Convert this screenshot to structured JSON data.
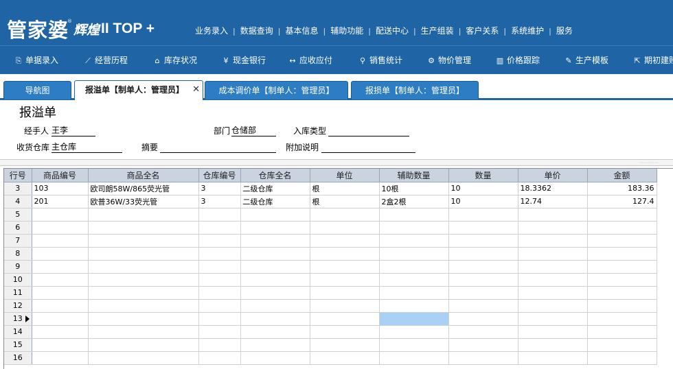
{
  "header": {
    "logo_main": "管家婆",
    "logo_reg": "®",
    "logo_sub": "辉煌",
    "logo_edition": "II TOP +",
    "menu": [
      "业务录入",
      "数据查询",
      "基本信息",
      "辅助功能",
      "配送中心",
      "生产组装",
      "客户关系",
      "系统维护",
      "服务"
    ],
    "menu_sep": "|"
  },
  "toolbar": [
    {
      "icon": "document-icon",
      "glyph": "⎘",
      "label": "单据录入"
    },
    {
      "icon": "trend-chart-icon",
      "glyph": "⟋",
      "label": "经营历程"
    },
    {
      "icon": "home-icon",
      "glyph": "⌂",
      "label": "库存状况"
    },
    {
      "icon": "yen-icon",
      "glyph": "¥",
      "label": "现金银行"
    },
    {
      "icon": "exchange-icon",
      "glyph": "↔",
      "label": "应收应付"
    },
    {
      "icon": "search-icon",
      "glyph": "⚲",
      "label": "销售统计"
    },
    {
      "icon": "gear-icon",
      "glyph": "⚙",
      "label": "物价管理"
    },
    {
      "icon": "bar-chart-icon",
      "glyph": "▥",
      "label": "价格跟踪"
    },
    {
      "icon": "wrench-icon",
      "glyph": "✎",
      "label": "生产模板"
    },
    {
      "icon": "external-link-icon",
      "glyph": "⇱",
      "label": "期初建账"
    }
  ],
  "tabs": [
    {
      "label": "导航图",
      "active": false
    },
    {
      "label": "报溢单【制单人：管理员】",
      "active": true,
      "close": "✕"
    },
    {
      "label": "成本调价单【制单人：管理员】",
      "active": false
    },
    {
      "label": "报损单【制单人：管理员】",
      "active": false
    }
  ],
  "form": {
    "title": "报溢单",
    "handler_label": "经手人",
    "handler_value": "王李",
    "dept_label": "部门",
    "dept_value": "仓储部",
    "intype_label": "入库类型",
    "intype_value": "",
    "warehouse_label": "收货仓库",
    "warehouse_value": "主仓库",
    "summary_label": "摘要",
    "summary_value": "",
    "note_label": "附加说明",
    "note_value": ""
  },
  "grid": {
    "columns": [
      "行号",
      "商品编号",
      "商品全名",
      "仓库编号",
      "仓库全名",
      "单位",
      "辅助数量",
      "数量",
      "单价",
      "金额"
    ],
    "rows": [
      {
        "no": "3",
        "cells": [
          "103",
          "欧司朗58W/865荧光管",
          "3",
          "二级仓库",
          "根",
          "10根",
          "10",
          "18.3362",
          "183.36"
        ]
      },
      {
        "no": "4",
        "cells": [
          "201",
          "欧普36W/33荧光管",
          "3",
          "二级仓库",
          "根",
          "2盒2根",
          "10",
          "12.74",
          "127.4"
        ]
      },
      {
        "no": "5",
        "cells": [
          "",
          "",
          "",
          "",
          "",
          "",
          "",
          "",
          ""
        ]
      },
      {
        "no": "6",
        "cells": [
          "",
          "",
          "",
          "",
          "",
          "",
          "",
          "",
          ""
        ]
      },
      {
        "no": "7",
        "cells": [
          "",
          "",
          "",
          "",
          "",
          "",
          "",
          "",
          ""
        ]
      },
      {
        "no": "8",
        "cells": [
          "",
          "",
          "",
          "",
          "",
          "",
          "",
          "",
          ""
        ]
      },
      {
        "no": "9",
        "cells": [
          "",
          "",
          "",
          "",
          "",
          "",
          "",
          "",
          ""
        ]
      },
      {
        "no": "10",
        "cells": [
          "",
          "",
          "",
          "",
          "",
          "",
          "",
          "",
          ""
        ]
      },
      {
        "no": "11",
        "cells": [
          "",
          "",
          "",
          "",
          "",
          "",
          "",
          "",
          ""
        ]
      },
      {
        "no": "12",
        "cells": [
          "",
          "",
          "",
          "",
          "",
          "",
          "",
          "",
          ""
        ]
      },
      {
        "no": "13",
        "cells": [
          "",
          "",
          "",
          "",
          "",
          "",
          "",
          "",
          ""
        ],
        "current": true,
        "selected_col": 5
      },
      {
        "no": "14",
        "cells": [
          "",
          "",
          "",
          "",
          "",
          "",
          "",
          "",
          ""
        ]
      },
      {
        "no": "15",
        "cells": [
          "",
          "",
          "",
          "",
          "",
          "",
          "",
          "",
          ""
        ]
      },
      {
        "no": "16",
        "cells": [
          "",
          "",
          "",
          "",
          "",
          "",
          "",
          "",
          ""
        ]
      }
    ]
  }
}
